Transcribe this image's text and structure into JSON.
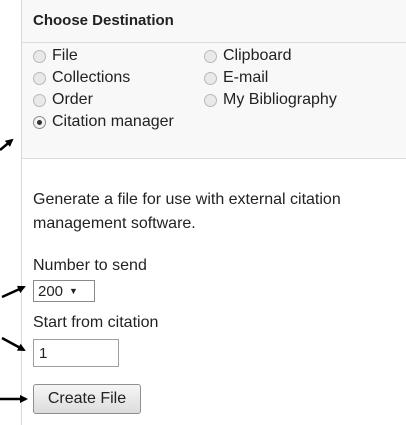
{
  "destination": {
    "title": "Choose Destination",
    "options": [
      {
        "label": "File",
        "checked": false
      },
      {
        "label": "Clipboard",
        "checked": false
      },
      {
        "label": "Collections",
        "checked": false
      },
      {
        "label": "E-mail",
        "checked": false
      },
      {
        "label": "Order",
        "checked": false
      },
      {
        "label": "My Bibliography",
        "checked": false
      },
      {
        "label": "Citation manager",
        "checked": true
      }
    ]
  },
  "citation": {
    "description": "Generate a file for use with external citation management software.",
    "number_label": "Number to send",
    "number_value": "200",
    "start_label": "Start from citation",
    "start_value": "1",
    "create_button": "Create File"
  }
}
